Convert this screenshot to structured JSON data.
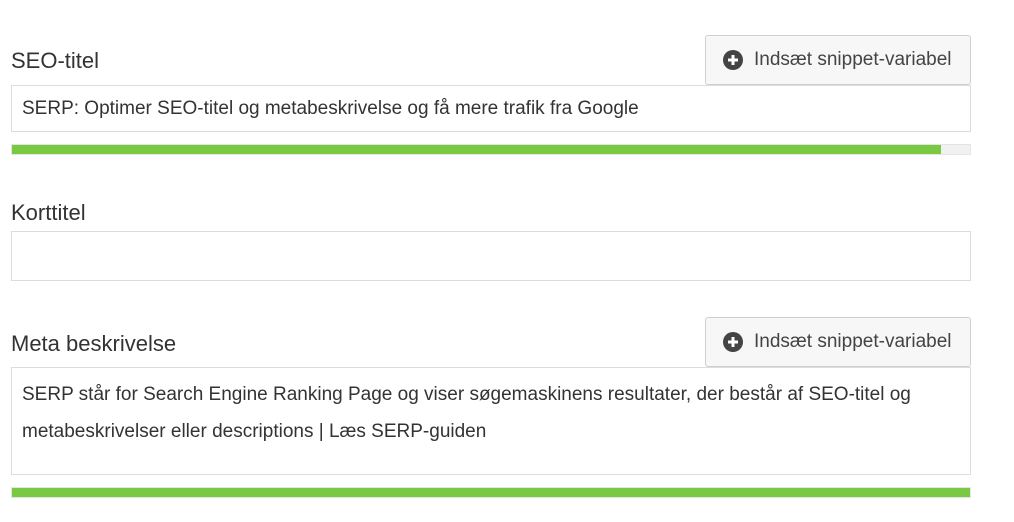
{
  "seo_title": {
    "label": "SEO-titel",
    "insert_button": "Indsæt snippet-variabel",
    "value": "SERP: Optimer SEO-titel og metabeskrivelse og få mere trafik fra Google",
    "progress_fraction": 0.97,
    "progress_color": "#7ac943"
  },
  "short_title": {
    "label": "Korttitel",
    "value": ""
  },
  "meta_description": {
    "label": "Meta beskrivelse",
    "insert_button": "Indsæt snippet-variabel",
    "value": "SERP står for Search Engine Ranking Page og viser søgemaskinens resultater, der består af SEO-titel og metabeskrivelser eller descriptions | Læs SERP-guiden",
    "progress_fraction": 1.0,
    "progress_color": "#7ac943"
  },
  "icons": {
    "insert_icon": "plus-circle-icon"
  }
}
